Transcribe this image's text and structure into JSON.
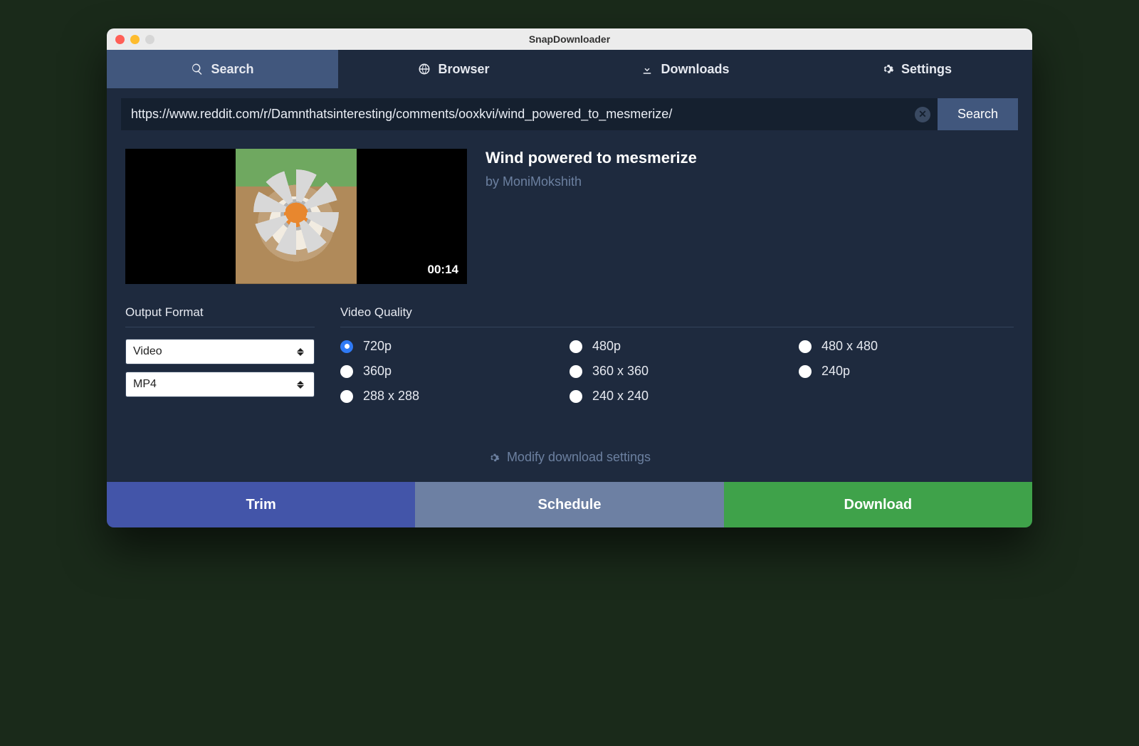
{
  "window": {
    "title": "SnapDownloader"
  },
  "tabs": {
    "search": "Search",
    "browser": "Browser",
    "downloads": "Downloads",
    "settings": "Settings"
  },
  "url": {
    "value": "https://www.reddit.com/r/Damnthatsinteresting/comments/ooxkvi/wind_powered_to_mesmerize/",
    "search_label": "Search"
  },
  "video": {
    "title": "Wind powered to mesmerize",
    "author": "by MoniMokshith",
    "duration": "00:14"
  },
  "output": {
    "section_label": "Output Format",
    "type": "Video",
    "container": "MP4"
  },
  "quality": {
    "section_label": "Video Quality",
    "options": [
      "720p",
      "480p",
      "480 x 480",
      "360p",
      "360 x 360",
      "240p",
      "288 x 288",
      "240 x 240"
    ],
    "selected": "720p"
  },
  "modify": {
    "label": "Modify download settings"
  },
  "footer": {
    "trim": "Trim",
    "schedule": "Schedule",
    "download": "Download"
  }
}
